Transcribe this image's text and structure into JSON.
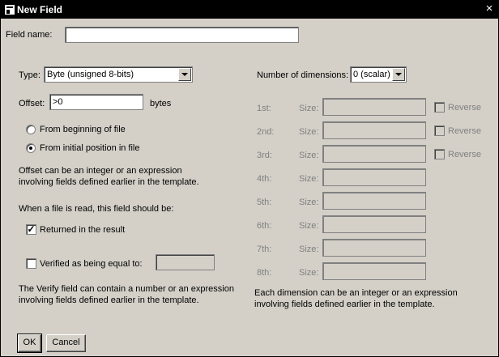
{
  "window": {
    "title": "New Field",
    "close_glyph": "×"
  },
  "field_name": {
    "label": "Field name:",
    "value": ""
  },
  "type": {
    "label": "Type:",
    "selected": "Byte (unsigned 8-bits)"
  },
  "offset": {
    "label": "Offset:",
    "value": ">0",
    "unit": "bytes",
    "options": [
      {
        "label": "From beginning of file",
        "selected": false
      },
      {
        "label": "From initial position in file",
        "selected": true
      }
    ],
    "help_line1": "Offset can be an integer or an expression",
    "help_line2": "involving fields defined earlier in the template."
  },
  "read_section": {
    "heading": "When a file is read, this field should be:",
    "returned_label": "Returned in the result",
    "returned_checked_glyph": "✓",
    "verified_label": "Verified as being equal to:",
    "verified_value": "",
    "verify_help_line1": "The Verify field can contain a number or an expression",
    "verify_help_line2": "involving fields defined earlier in the template."
  },
  "dimensions": {
    "label": "Number of dimensions:",
    "selected": "0 (scalar)",
    "size_label": "Size:",
    "reverse_label": "Reverse",
    "rows": [
      {
        "ordinal": "1st:",
        "has_reverse": true
      },
      {
        "ordinal": "2nd:",
        "has_reverse": true
      },
      {
        "ordinal": "3rd:",
        "has_reverse": true
      },
      {
        "ordinal": "4th:",
        "has_reverse": false
      },
      {
        "ordinal": "5th:",
        "has_reverse": false
      },
      {
        "ordinal": "6th:",
        "has_reverse": false
      },
      {
        "ordinal": "7th:",
        "has_reverse": false
      },
      {
        "ordinal": "8th:",
        "has_reverse": false
      }
    ],
    "help_line1": "Each dimension can be an integer or an expression",
    "help_line2": "involving fields defined earlier in the template."
  },
  "buttons": {
    "ok": "OK",
    "cancel": "Cancel"
  }
}
